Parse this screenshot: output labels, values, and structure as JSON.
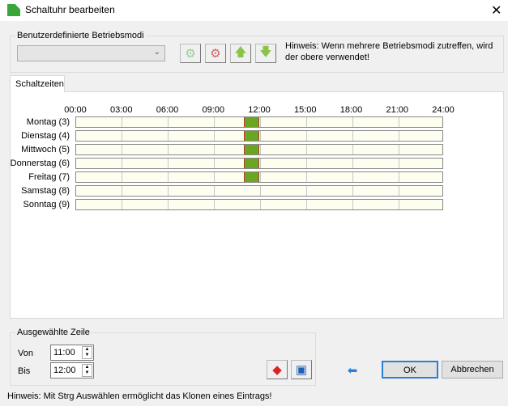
{
  "window": {
    "title": "Schaltuhr bearbeiten",
    "close": "✕"
  },
  "modes": {
    "legend": "Benutzerdefinierte Betriebsmodi",
    "combo_value": "",
    "hint": "Hinweis: Wenn mehrere Betriebsmodi zutreffen, wird der obere verwendet!"
  },
  "tabs": [
    {
      "label": "Schaltzeiten"
    }
  ],
  "schedule": {
    "ticks": [
      "00:00",
      "03:00",
      "06:00",
      "09:00",
      "12:00",
      "15:00",
      "18:00",
      "21:00",
      "24:00"
    ],
    "days": [
      {
        "label": "Montag (3)",
        "segments": [
          {
            "from": 11,
            "to": 12,
            "selected": true
          }
        ]
      },
      {
        "label": "Dienstag (4)",
        "segments": [
          {
            "from": 11,
            "to": 12
          }
        ]
      },
      {
        "label": "Mittwoch (5)",
        "segments": [
          {
            "from": 11,
            "to": 12
          }
        ]
      },
      {
        "label": "Donnerstag (6)",
        "segments": [
          {
            "from": 11,
            "to": 12
          }
        ]
      },
      {
        "label": "Freitag (7)",
        "segments": [
          {
            "from": 11,
            "to": 12
          }
        ]
      },
      {
        "label": "Samstag (8)",
        "segments": []
      },
      {
        "label": "Sonntag (9)",
        "segments": []
      }
    ]
  },
  "selected_row": {
    "legend": "Ausgewählte Zeile",
    "von_label": "Von",
    "von": "11:00",
    "bis_label": "Bis",
    "bis": "12:00"
  },
  "buttons": {
    "ok": "OK",
    "cancel": "Abbrechen"
  },
  "footer_hint": "Hinweis: Mit Strg Auswählen ermöglicht das Klonen eines Eintrags!"
}
